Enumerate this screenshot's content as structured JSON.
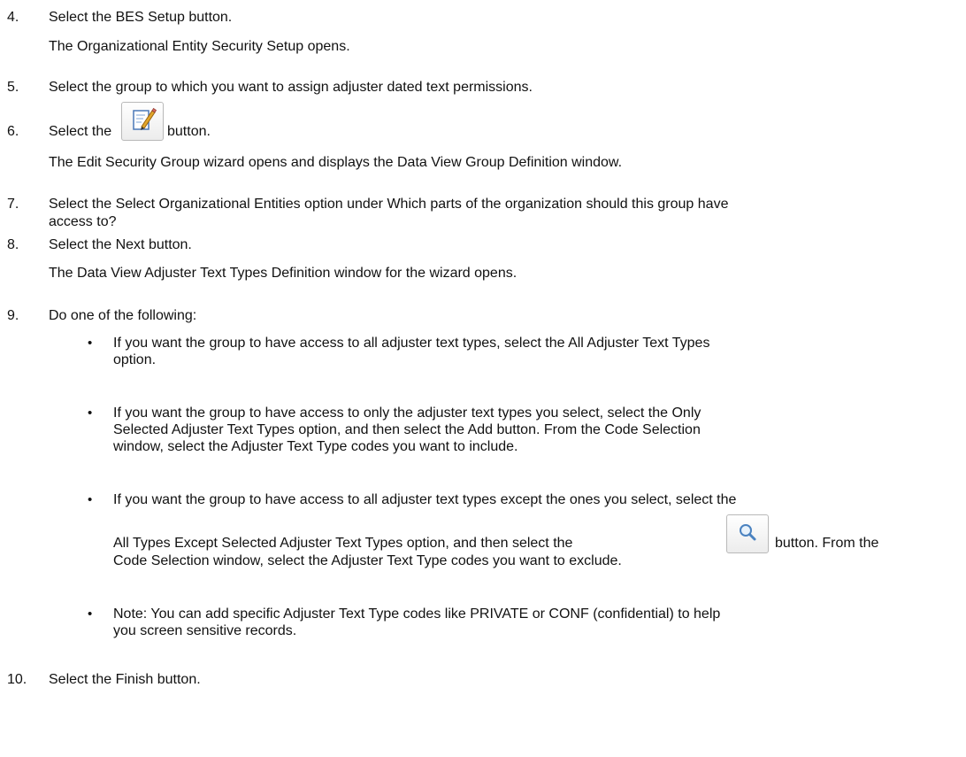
{
  "steps": [
    {
      "num": "4.",
      "text": "Select the BES Setup button.",
      "sub": "The Organizational Entity Security Setup opens."
    },
    {
      "num": "5.",
      "text": "Select the group to which you want to assign adjuster dated text permissions."
    },
    {
      "num": "6.",
      "text_before": "Select the",
      "text_after": "button.",
      "icon": "edit-pencil-icon",
      "sub": "The Edit Security Group wizard opens and displays the Data View Group Definition window."
    },
    {
      "num": "7.",
      "line1": "Select the Select Organizational Entities option under Which parts of the organization should this group have",
      "line2": "access to?"
    },
    {
      "num": "8.",
      "text": "Select the Next button.",
      "sub": "The Data View Adjuster Text Types Definition window for the wizard opens."
    },
    {
      "num": "9.",
      "text": "Do one of the following:"
    },
    {
      "num": "10.",
      "text": "Select the Finish button."
    }
  ],
  "bullets": [
    {
      "marker": "•",
      "line1": "If you want the group to have access to all adjuster text types, select the All Adjuster Text Types",
      "line2": "option."
    },
    {
      "marker": "•",
      "line1": "If you want the group to have access to only the adjuster text types you select, select the Only",
      "line2": "Selected Adjuster Text Types option, and then select the Add button. From the Code Selection",
      "line3": "window, select the Adjuster Text Type codes you want to include."
    },
    {
      "marker": "•",
      "line1": "If you want the group to have access to all adjuster text types except the ones you select, select the",
      "line2_before": "All Types Except Selected Adjuster Text Types option, and then select the",
      "icon": "search-magnifier-icon",
      "line2_after": "button. From the",
      "line3": "Code Selection window, select the Adjuster Text Type codes you want to exclude."
    },
    {
      "marker": "•",
      "line1": "Note: You can add specific Adjuster Text Type codes like PRIVATE or CONF (confidential) to help",
      "line2": "you screen sensitive records."
    }
  ]
}
